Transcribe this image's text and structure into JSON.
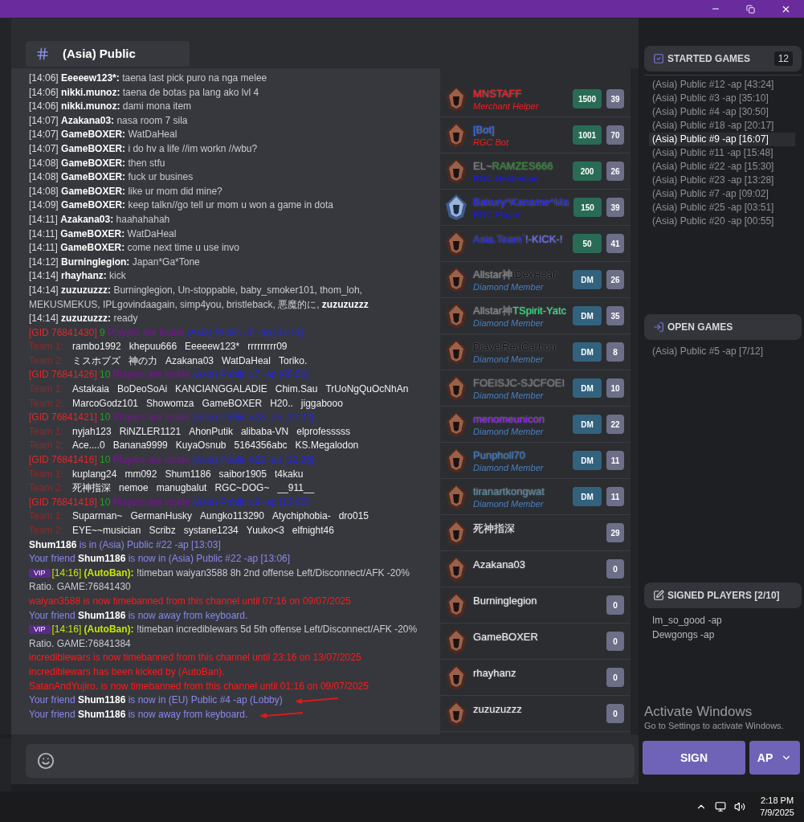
{
  "channel": {
    "name": "(Asia) Public"
  },
  "chat": [
    {
      "kind": "msg",
      "time": "[14:06]",
      "user": "Eeeeew123*:",
      "text": "taena last pick puro na nga melee"
    },
    {
      "kind": "msg",
      "time": "[14:06]",
      "user": "nikki.munoz:",
      "text": "taena de botas pa lang ako lvl 4"
    },
    {
      "kind": "msg",
      "time": "[14:06]",
      "user": "nikki.munoz:",
      "text": "dami mona item"
    },
    {
      "kind": "msg",
      "time": "[14:07]",
      "user": "Azakana03:",
      "text": "nasa room 7 sila"
    },
    {
      "kind": "msg",
      "time": "[14:07]",
      "user": "GameBOXER:",
      "text": "WatDaHeal"
    },
    {
      "kind": "msg",
      "time": "[14:07]",
      "user": "GameBOXER:",
      "text": "i do hv a life //im workn //wbu?"
    },
    {
      "kind": "msg",
      "time": "[14:08]",
      "user": "GameBOXER:",
      "text": "then stfu"
    },
    {
      "kind": "msg",
      "time": "[14:08]",
      "user": "GameBOXER:",
      "text": "fuck ur busines"
    },
    {
      "kind": "msg",
      "time": "[14:08]",
      "user": "GameBOXER:",
      "text": "like ur mom did mine?"
    },
    {
      "kind": "msg",
      "time": "[14:09]",
      "user": "GameBOXER:",
      "text": "keep talkn//go tell ur mom u won a game in dota"
    },
    {
      "kind": "msg",
      "time": "[14:11]",
      "user": "Azakana03:",
      "text": "haahahahah"
    },
    {
      "kind": "msg",
      "time": "[14:11]",
      "user": "GameBOXER:",
      "text": "WatDaHeal"
    },
    {
      "kind": "msg",
      "time": "[14:11]",
      "user": "GameBOXER:",
      "text": "come next time u use invo"
    },
    {
      "kind": "msg",
      "time": "[14:12]",
      "user": "Burninglegion:",
      "text": "Japan*Ga*Tone"
    },
    {
      "kind": "msg",
      "time": "[14:14]",
      "user": "rhayhanz:",
      "text": "kick"
    },
    {
      "kind": "msg",
      "time": "[14:14]",
      "user": "zuzuzuzzz:",
      "text": "Burninglegion, Un-stoppable, baby_smoker101, thom_loh, MEKUSMEKUS, IPLgovindaagain, simp4you, bristleback, 悪魔的に, **zuzuzuzzz**"
    },
    {
      "kind": "msg",
      "time": "[14:14]",
      "user": "zuzuzuzzz:",
      "text": "ready"
    },
    {
      "kind": "game",
      "gid": "[GID 76841430]",
      "count": "9",
      "status": "Players are inside",
      "room": "(Asia) Public #6 -ap [04:43]"
    },
    {
      "kind": "team",
      "label": "Team 1:",
      "players": [
        "rambo1992",
        "khepuu666",
        "Eeeeew123*",
        "rrrrrrrrr09"
      ]
    },
    {
      "kind": "team",
      "label": "Team 2:",
      "players": [
        "ミスホブズ",
        "神の力",
        "Azakana03",
        "WatDaHeal",
        "Toriko."
      ]
    },
    {
      "kind": "game",
      "gid": "[GID 76841426]",
      "count": "10",
      "status": "Players are inside",
      "room": "(Asia) Public #7 -ap [05:56]"
    },
    {
      "kind": "team",
      "label": "Team 1:",
      "players": [
        "Astakaia",
        "BoDeoSoAi",
        "KANCIANGGALADIE",
        "Chim.Sau",
        "TrUoNgQuOcNhAn"
      ]
    },
    {
      "kind": "team",
      "label": "Team 2:",
      "players": [
        "MarcoGodz101",
        "Showomza",
        "GameBOXER",
        "H20..",
        "jiggabooo"
      ]
    },
    {
      "kind": "game",
      "gid": "[GID 76841421]",
      "count": "10",
      "status": "Players are inside",
      "room": "(Asia) Public #23 -ap [10:22]"
    },
    {
      "kind": "team",
      "label": "Team 1:",
      "players": [
        "nyjah123",
        "RiNZLER1121",
        "AhonPutik",
        "alibaba-VN",
        "elprofesssss"
      ]
    },
    {
      "kind": "team",
      "label": "Team 2:",
      "players": [
        "Ace....0",
        "Banana9999",
        "KuyaOsnub",
        "5164356abc",
        "KS.Megalodon"
      ]
    },
    {
      "kind": "game",
      "gid": "[GID 76841416]",
      "count": "10",
      "status": "Players are inside",
      "room": "(Asia) Public #22 -ap [12:25]"
    },
    {
      "kind": "team",
      "label": "Team 1:",
      "players": [
        "kuplang24",
        "mm092",
        "Shum1186",
        "saibor1905",
        "t4kaku"
      ]
    },
    {
      "kind": "team",
      "label": "Team 2:",
      "players": [
        "死神指深",
        "nemoe",
        "manugbalut",
        "RGC~DOG~",
        "__911__"
      ]
    },
    {
      "kind": "game",
      "gid": "[GID 76841418]",
      "count": "10",
      "status": "Players are inside",
      "room": "(Asia) Public #9 -ap [13:02]"
    },
    {
      "kind": "team",
      "label": "Team 1:",
      "players": [
        "Suparman~",
        "GermanHusky",
        "Aungko113290",
        "Atychiphobia-",
        "dro015"
      ]
    },
    {
      "kind": "team",
      "label": "Team 2:",
      "players": [
        "EYE~~musician",
        "Scribz",
        "systane1234",
        "Yuuko<3",
        "elfnight46"
      ]
    },
    {
      "kind": "status",
      "text": "**Shum1186** is in (Asia) Public #22 -ap [13:03]",
      "arrow": false
    },
    {
      "kind": "status",
      "text": "Your friend **Shum1186** is now in (Asia) Public #22 -ap [13:06]",
      "arrow": false
    },
    {
      "kind": "autoban",
      "badge": "VIP",
      "time": "[14:16]",
      "user": "(AutoBan):",
      "text": "!timeban waiyan3588 8h 2nd offense Left/Disconnect/AFK -20% Ratio. GAME:76841430"
    },
    {
      "kind": "alert",
      "text": "waiyan3588 is now timebanned from this channel until 07:16 on 09/07/2025"
    },
    {
      "kind": "status",
      "text": "Your friend **Shum1186** is now away from keyboard.",
      "arrow": false
    },
    {
      "kind": "autoban",
      "badge": "VIP",
      "time": "[14:16]",
      "user": "(AutoBan):",
      "text": "!timeban incrediblewars 5d 5th offense Left/Disconnect/AFK -20% Ratio. GAME:76841384"
    },
    {
      "kind": "alert",
      "text": "incrediblewars is now timebanned from this channel until 23:16 on 13/07/2025"
    },
    {
      "kind": "alert",
      "text": "incrediblewars has been kicked by (AutoBan)."
    },
    {
      "kind": "alert",
      "text": "SatanAndYujiro. is now timebanned from this channel until 01:16 on 09/07/2025"
    },
    {
      "kind": "status",
      "text": "Your friend **Shum1186** is now in (EU) Public #4 -ap (Lobby)",
      "arrow": true
    },
    {
      "kind": "status",
      "text": "Your friend **Shum1186** is now away from keyboard.",
      "arrow": true
    }
  ],
  "players": [
    {
      "kind": "bronze",
      "name": [
        {
          "text": "MNSTAFF",
          "color": "#ff1a1a"
        }
      ],
      "title": {
        "text": "Merchant Helper",
        "color": "#ff1a1a",
        "italic": true
      },
      "rank": {
        "kind": "points",
        "text": "1500"
      },
      "count": "39"
    },
    {
      "kind": "bronze",
      "name": [
        {
          "text": "[Bot]",
          "color": "#2d6bff"
        }
      ],
      "title": {
        "text": "RGC Bot",
        "color": "#ff1a1a",
        "italic": true
      },
      "rank": {
        "kind": "points",
        "text": "1001"
      },
      "count": "70"
    },
    {
      "kind": "bronze",
      "name": [
        {
          "text": "EL~",
          "color": "#808080"
        },
        {
          "text": "RAMZES666",
          "color": "#2e8b2e"
        }
      ],
      "title": {
        "text": "RGC Gentleman",
        "color": "#1a1aff",
        "italic": false
      },
      "rank": {
        "kind": "points",
        "text": "200"
      },
      "count": "26"
    },
    {
      "kind": "silver",
      "name": [
        {
          "text": "Bakury^Kaname^Ma",
          "color": "#1a1aff"
        }
      ],
      "title": {
        "text": "RGC Player",
        "color": "#1a1aff",
        "italic": false
      },
      "rank": {
        "kind": "points",
        "text": "150"
      },
      "count": "39"
    },
    {
      "kind": "bronze",
      "name": [
        {
          "text": "Asia.Team`",
          "color": "#1a1aff"
        },
        {
          "text": "!-KICK-!",
          "color": "#6a6aff"
        }
      ],
      "rank": {
        "kind": "points",
        "text": "50"
      },
      "count": "41"
    },
    {
      "kind": "bronze",
      "name": [
        {
          "text": "Allstar神",
          "color": "#888888"
        },
        {
          "text": "iDexHear‘’",
          "color": "#111111"
        }
      ],
      "title": {
        "text": "Diamond Member",
        "color": "#4a7fbf",
        "italic": true
      },
      "rank": {
        "kind": "dm",
        "text": "DM"
      },
      "count": "26"
    },
    {
      "kind": "bronze",
      "name": [
        {
          "text": "Allstar神",
          "color": "#888888"
        },
        {
          "text": "TSpirit-Yatc",
          "color": "#22ee77"
        }
      ],
      "title": {
        "text": "Diamond Member",
        "color": "#4a7fbf",
        "italic": true
      },
      "rank": {
        "kind": "dm",
        "text": "DM"
      },
      "count": "35"
    },
    {
      "kind": "bronze",
      "name": [
        {
          "text": "DiavelRedCarbon",
          "color": "#111111"
        }
      ],
      "title": {
        "text": "Diamond Member",
        "color": "#4a7fbf",
        "italic": true
      },
      "rank": {
        "kind": "dm",
        "text": "DM"
      },
      "count": "8"
    },
    {
      "kind": "bronze",
      "name": [
        {
          "text": "FOEISJC-SJCFOEI",
          "color": "#777777"
        }
      ],
      "title": {
        "text": "Diamond Member",
        "color": "#4a7fbf",
        "italic": true
      },
      "rank": {
        "kind": "dm",
        "text": "DM"
      },
      "count": "10"
    },
    {
      "kind": "bronze",
      "name": [
        {
          "text": "menomeunicon",
          "color": "#9a1aff"
        }
      ],
      "title": {
        "text": "Diamond Member",
        "color": "#4a7fbf",
        "italic": true
      },
      "rank": {
        "kind": "dm",
        "text": "DM"
      },
      "count": "22"
    },
    {
      "kind": "bronze",
      "name": [
        {
          "text": "Punpholl70",
          "color": "#3a78c0"
        }
      ],
      "title": {
        "text": "Diamond Member",
        "color": "#4a7fbf",
        "italic": true
      },
      "rank": {
        "kind": "dm",
        "text": "DM"
      },
      "count": "11"
    },
    {
      "kind": "bronze",
      "name": [
        {
          "text": "tiranartkongwat",
          "color": "#5a8aa0"
        }
      ],
      "title": {
        "text": "Diamond Member",
        "color": "#4a7fbf",
        "italic": true
      },
      "rank": {
        "kind": "dm",
        "text": "DM"
      },
      "count": "11"
    },
    {
      "kind": "bronze",
      "name": [
        {
          "text": "死神指深",
          "color": "#f0f0f0"
        }
      ],
      "count": "29"
    },
    {
      "kind": "bronze",
      "name": [
        {
          "text": "Azakana03",
          "color": "#f0f0f0"
        }
      ],
      "count": "0"
    },
    {
      "kind": "bronze",
      "name": [
        {
          "text": "Burninglegion",
          "color": "#f0f0f0"
        }
      ],
      "count": "0"
    },
    {
      "kind": "bronze",
      "name": [
        {
          "text": "GameBOXER",
          "color": "#f0f0f0"
        }
      ],
      "count": "0"
    },
    {
      "kind": "bronze",
      "name": [
        {
          "text": "rhayhanz",
          "color": "#f0f0f0"
        }
      ],
      "count": "0"
    },
    {
      "kind": "bronze",
      "name": [
        {
          "text": "zuzuzuzzz",
          "color": "#f0f0f0"
        }
      ],
      "count": "0"
    }
  ],
  "started_games": {
    "title": "STARTED GAMES",
    "count": "12",
    "items": [
      {
        "label": "(Asia) Public #12 -ap [43:24]",
        "selected": false
      },
      {
        "label": "(Asia) Public #3 -ap [35:10]",
        "selected": false
      },
      {
        "label": "(Asia) Public #4 -ap [30:50]",
        "selected": false
      },
      {
        "label": "(Asia) Public #18 -ap [20:17]",
        "selected": false
      },
      {
        "label": "(Asia) Public #9 -ap [16:07]",
        "selected": true
      },
      {
        "label": "(Asia) Public #11 -ap [15:48]",
        "selected": false
      },
      {
        "label": "(Asia) Public #22 -ap [15:30]",
        "selected": false
      },
      {
        "label": "(Asia) Public #23 -ap [13:28]",
        "selected": false
      },
      {
        "label": "(Asia) Public #7 -ap [09:02]",
        "selected": false
      },
      {
        "label": "(Asia) Public #25 -ap [03:51]",
        "selected": false
      },
      {
        "label": "(Asia) Public #20 -ap [00:55]",
        "selected": false
      }
    ]
  },
  "open_games": {
    "title": "OPEN GAMES",
    "items": [
      "(Asia) Public #5 -ap [7/12]"
    ]
  },
  "signed_players": {
    "title": "SIGNED PLAYERS [2/10]",
    "items": [
      "Im_so_good -ap",
      "Dewgongs -ap"
    ]
  },
  "sign_button": "SIGN",
  "mode_select": "AP",
  "activation": {
    "title": "Activate Windows",
    "text": "Go to Settings to activate Windows."
  },
  "taskbar": {
    "time": "2:18 PM",
    "date": "7/9/2025"
  }
}
